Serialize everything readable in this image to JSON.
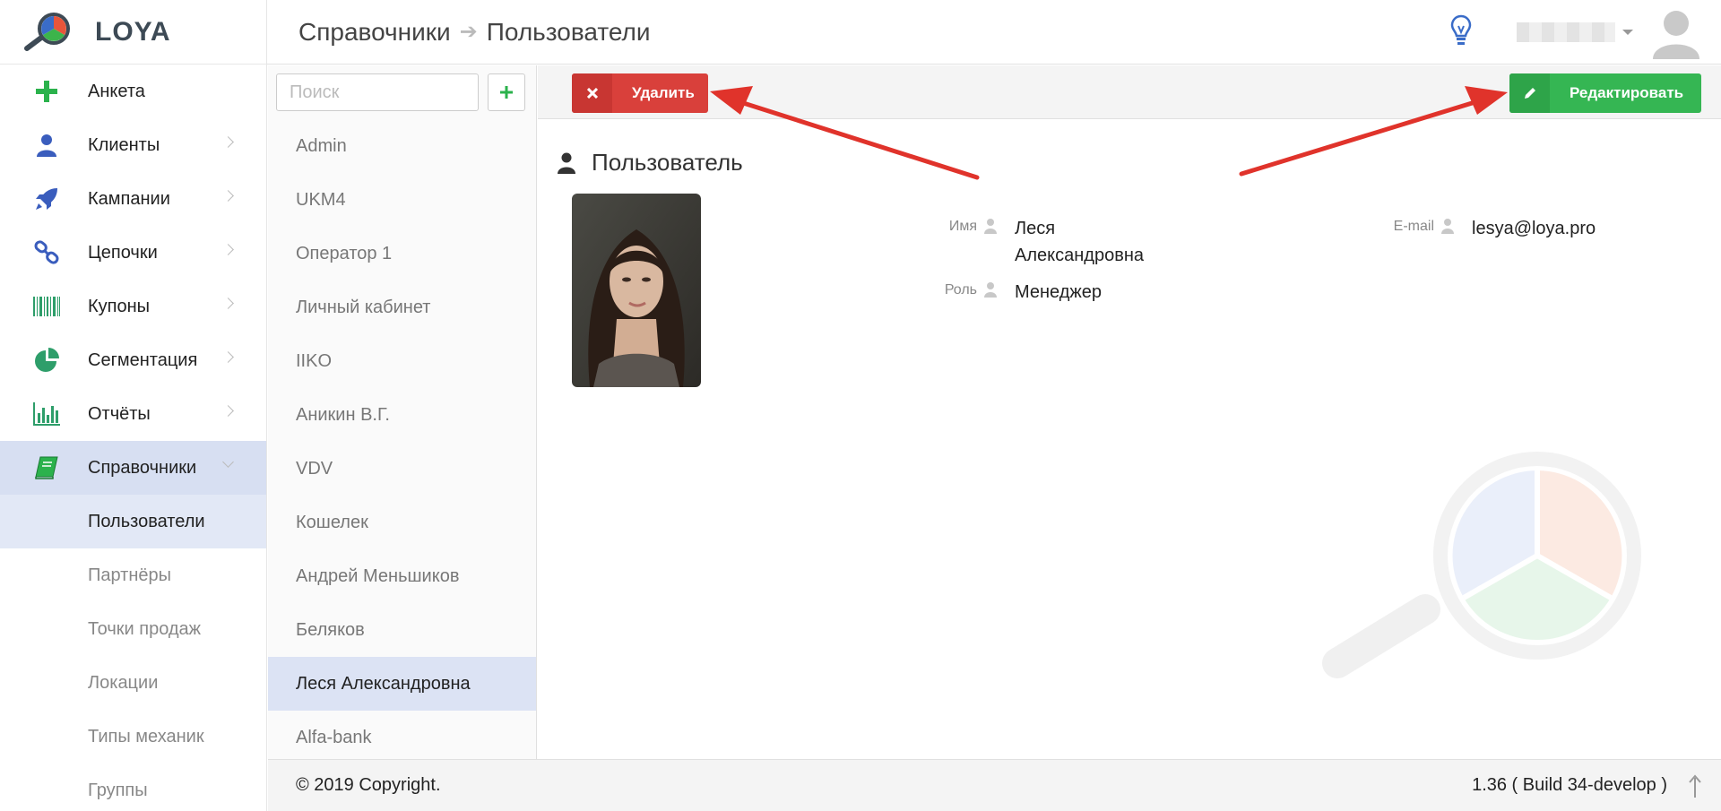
{
  "app": {
    "name": "LOYA"
  },
  "sidebar": {
    "items": [
      {
        "label": "Анкета"
      },
      {
        "label": "Клиенты"
      },
      {
        "label": "Кампании"
      },
      {
        "label": "Цепочки"
      },
      {
        "label": "Купоны"
      },
      {
        "label": "Сегментация"
      },
      {
        "label": "Отчёты"
      },
      {
        "label": "Справочники"
      }
    ],
    "subitems": [
      {
        "label": "Пользователи"
      },
      {
        "label": "Партнёры"
      },
      {
        "label": "Точки продаж"
      },
      {
        "label": "Локации"
      },
      {
        "label": "Типы механик"
      },
      {
        "label": "Группы"
      }
    ]
  },
  "header": {
    "breadcrumb": {
      "parent": "Справочники",
      "current": "Пользователи"
    },
    "arrow": "➔"
  },
  "list": {
    "search_placeholder": "Поиск",
    "add_label": "+",
    "items": [
      "Admin",
      "UKM4",
      "Оператор 1",
      "Личный кабинет",
      "IIKO",
      "Аникин В.Г.",
      "VDV",
      "Кошелек",
      "Андрей Меньшиков",
      "Беляков",
      "Леся Александровна",
      "Alfa-bank"
    ],
    "selected": "Леся Александровна"
  },
  "toolbar": {
    "delete_label": "Удалить",
    "edit_label": "Редактировать"
  },
  "user": {
    "section_title": "Пользователь",
    "name_label": "Имя",
    "name_value": "Леся Александровна",
    "role_label": "Роль",
    "role_value": "Менеджер",
    "email_label": "E-mail",
    "email_value": "lesya@loya.pro"
  },
  "footer": {
    "copyright": "© 2019 Copyright.",
    "version": "1.36 ( Build 34-develop )"
  },
  "colors": {
    "delete": "#d9403b",
    "edit": "#35b653",
    "active_bg": "#d7dff2",
    "annotation_arrow": "#e0332b"
  }
}
